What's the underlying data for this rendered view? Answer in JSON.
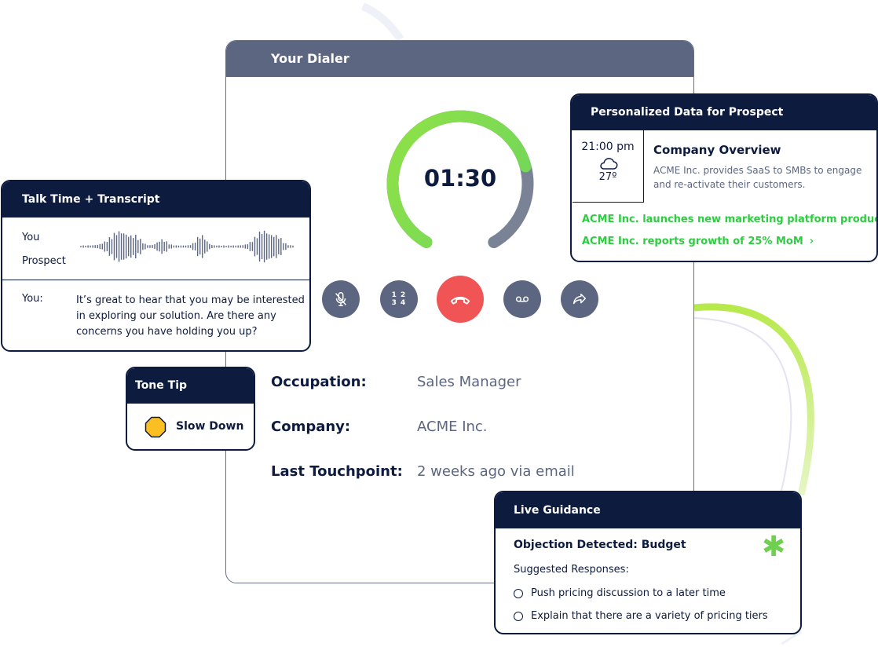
{
  "dialer": {
    "title": "Your Dialer",
    "timer": "01:30",
    "timer_progress": 0.75,
    "controls": [
      "mute-microphone",
      "keypad",
      "end-call",
      "voicemail",
      "forward-call"
    ],
    "keypad_digits": "1 2 3 4",
    "fields": [
      {
        "label": "Occupation:",
        "value": "Sales Manager"
      },
      {
        "label": "Company:",
        "value": "ACME Inc."
      },
      {
        "label": "Last Touchpoint:",
        "value": "2 weeks ago via email"
      }
    ]
  },
  "talk": {
    "title": "Talk Time + Transcript",
    "row_you": "You",
    "row_prospect": "Prospect",
    "speaker": "You:",
    "transcript": "It’s great to hear that you may be interested in exploring our solution. Are there any concerns you have holding you up?"
  },
  "tone": {
    "title": "Tone Tip",
    "tip": "Slow Down",
    "dot_color": "#fbbf24"
  },
  "personalized": {
    "title": "Personalized Data for Prospect",
    "time": "21:00 pm",
    "weather_icon": "cloud-icon",
    "temp": "27º",
    "overview_title": "Company Overview",
    "overview_text": "ACME Inc. provides SaaS to SMBs to engage and re-activate their customers.",
    "news": [
      "ACME Inc. launches new marketing platform product",
      "ACME Inc. reports growth of 25% MoM"
    ]
  },
  "live": {
    "title": "Live Guidance",
    "objection": "Objection Detected: Budget",
    "suggested_label": "Suggested Responses:",
    "options": [
      "Push pricing discussion to a later time",
      "Explain that there are a variety of pricing tiers"
    ]
  },
  "colors": {
    "navy": "#0d1b3e",
    "slate": "#5c6680",
    "green": "#2ecc40",
    "red": "#f05454",
    "accent_asterisk": "#6fd04f"
  }
}
